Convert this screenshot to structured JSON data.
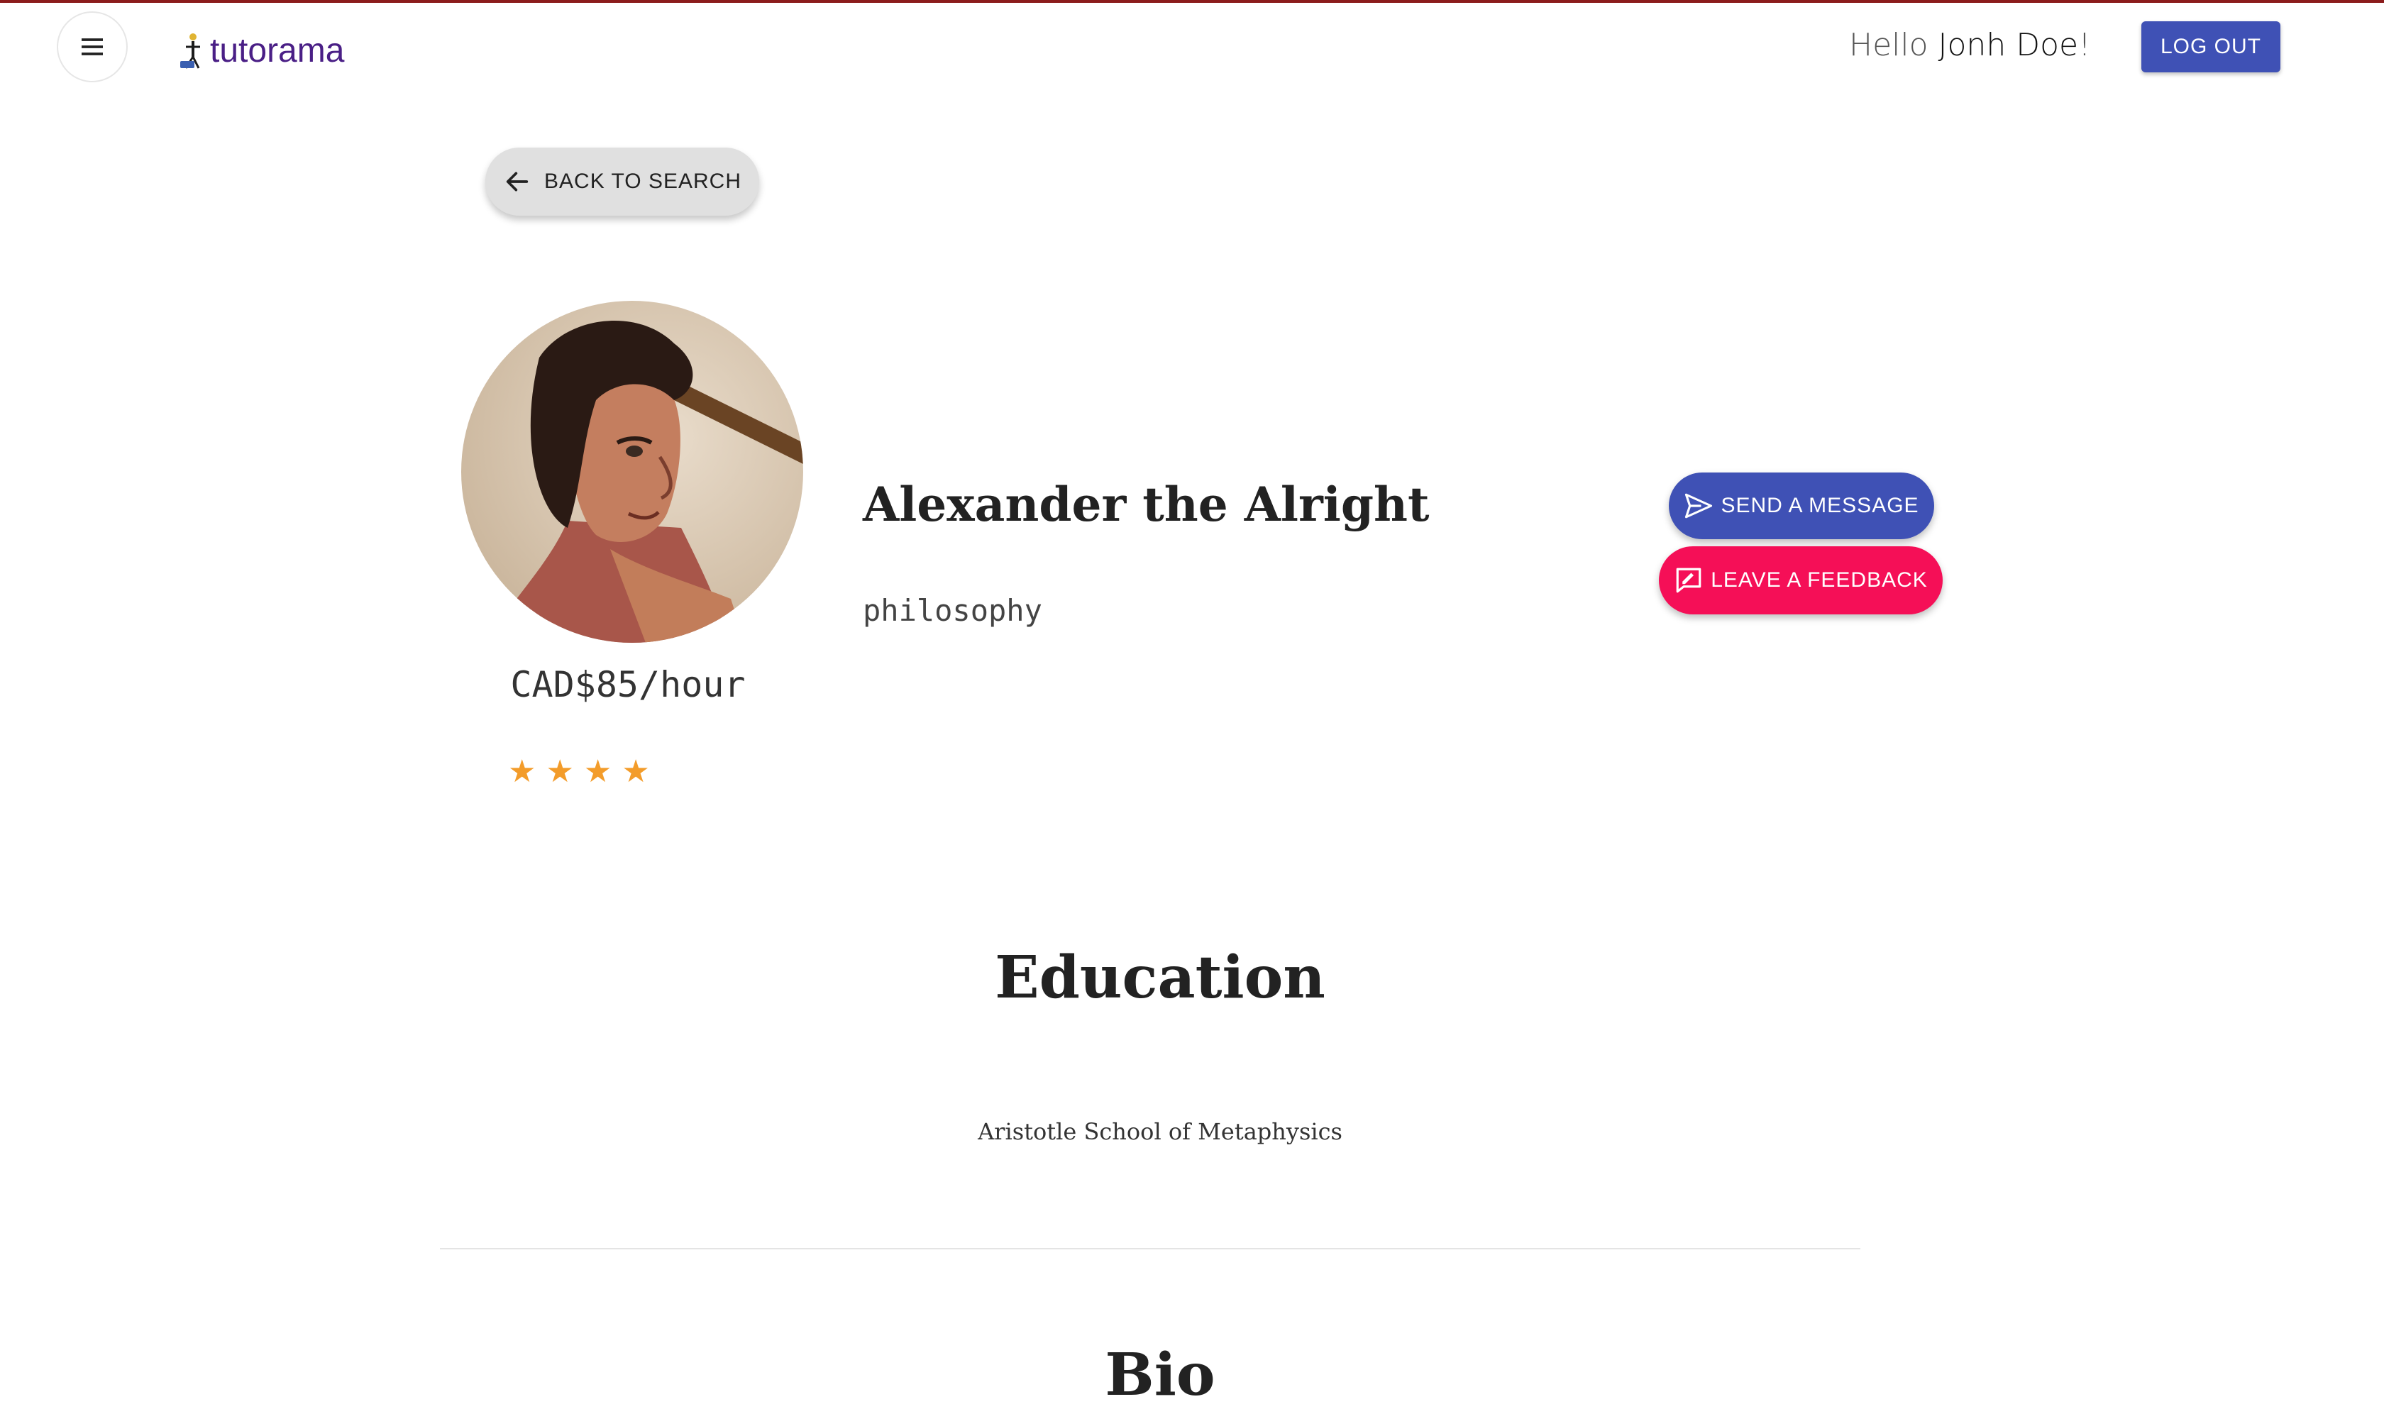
{
  "header": {
    "logo_text": "tutorama",
    "greeting_prefix": "Hello",
    "user_name": "Jonh Doe",
    "greeting_suffix": "!",
    "logout_label": "LOG OUT"
  },
  "back": {
    "label": "BACK TO SEARCH"
  },
  "tutor": {
    "name": "Alexander the Alright",
    "subject": "philosophy",
    "rate": "CAD$85/hour",
    "rating": 4,
    "stars": [
      "★",
      "★",
      "★",
      "★"
    ]
  },
  "actions": {
    "send_message_label": "SEND A MESSAGE",
    "leave_feedback_label": "LEAVE A FEEDBACK"
  },
  "education": {
    "title": "Education",
    "school": "Aristotle School of Metaphysics"
  },
  "bio": {
    "title": "Bio"
  },
  "colors": {
    "primary": "#3f51b5",
    "secondary": "#f50f57",
    "brand": "#4a1f86",
    "star": "#f39c2a",
    "top_rule": "#8b1c1c"
  },
  "icons": {
    "menu": "menu-icon",
    "back": "arrow-left-icon",
    "send": "send-icon",
    "feedback": "feedback-icon",
    "star": "star-icon"
  }
}
